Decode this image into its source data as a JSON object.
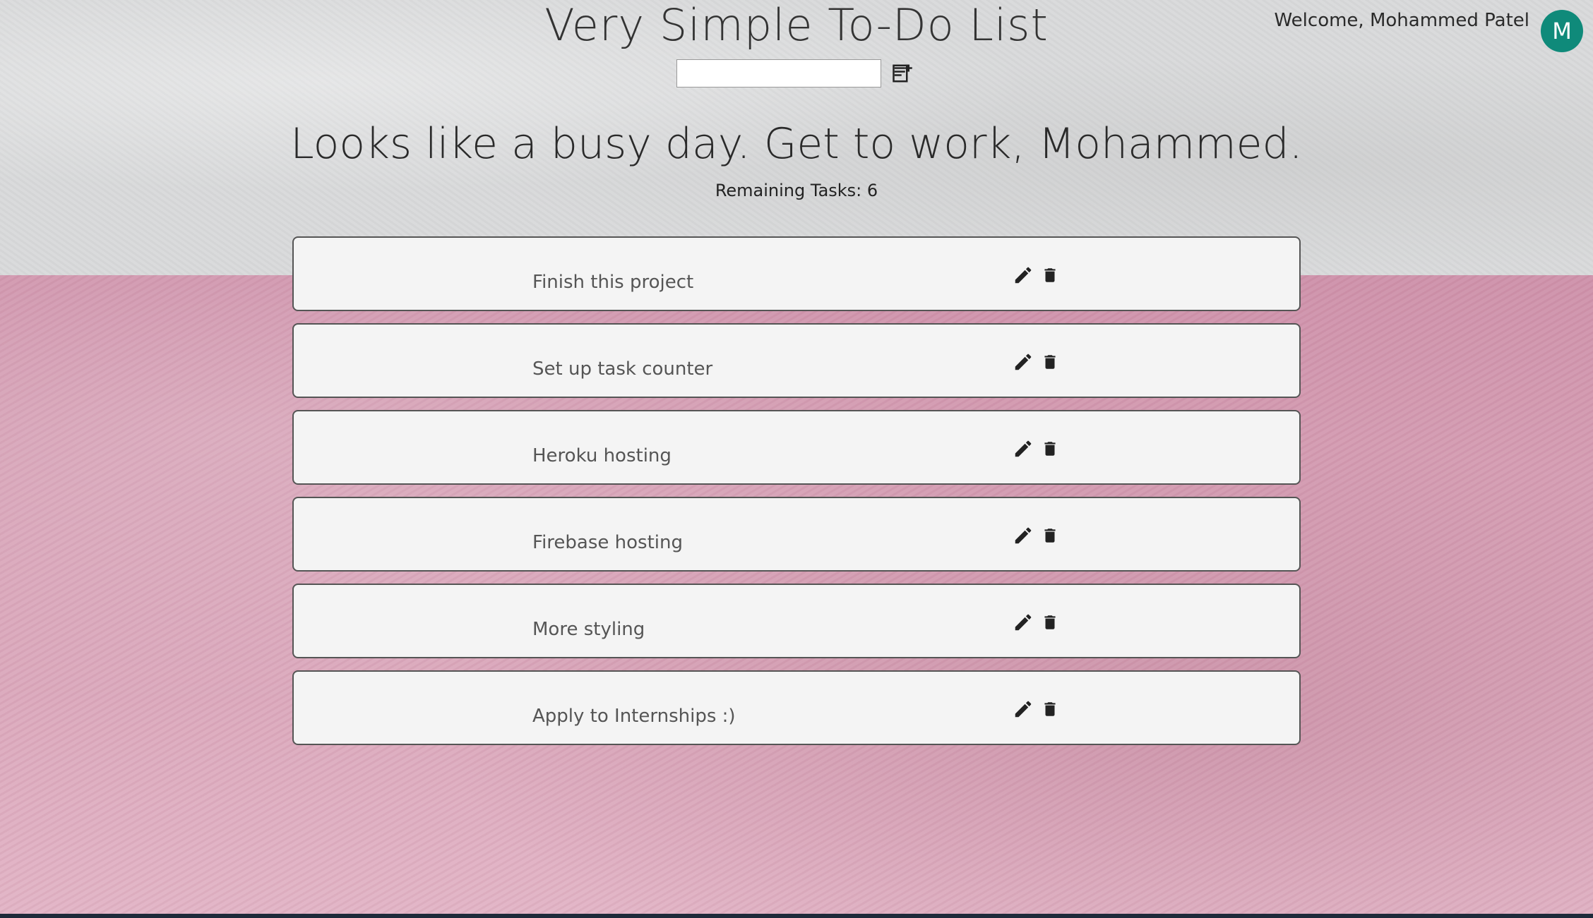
{
  "app": {
    "title": "Very Simple To-Do List"
  },
  "user": {
    "welcome": "Welcome, Mohammed Patel",
    "avatar_initial": "M",
    "avatar_color": "#0f8a7a"
  },
  "add_task": {
    "value": "",
    "placeholder": "",
    "icon": "note-add-icon"
  },
  "headline": "Looks like a busy day. Get to work, Mohammed.",
  "remaining": "Remaining Tasks: 6",
  "tasks": [
    {
      "text": "Finish this project"
    },
    {
      "text": "Set up task counter"
    },
    {
      "text": "Heroku hosting"
    },
    {
      "text": "Firebase hosting"
    },
    {
      "text": "More styling"
    },
    {
      "text": "Apply to Internships :)"
    }
  ],
  "icons": {
    "edit": "pencil-icon",
    "delete": "trash-icon"
  },
  "colors": {
    "top_wall": "#d9dadb",
    "bottom_wall": "#d7a4b8",
    "card_bg": "#f4f4f4"
  }
}
